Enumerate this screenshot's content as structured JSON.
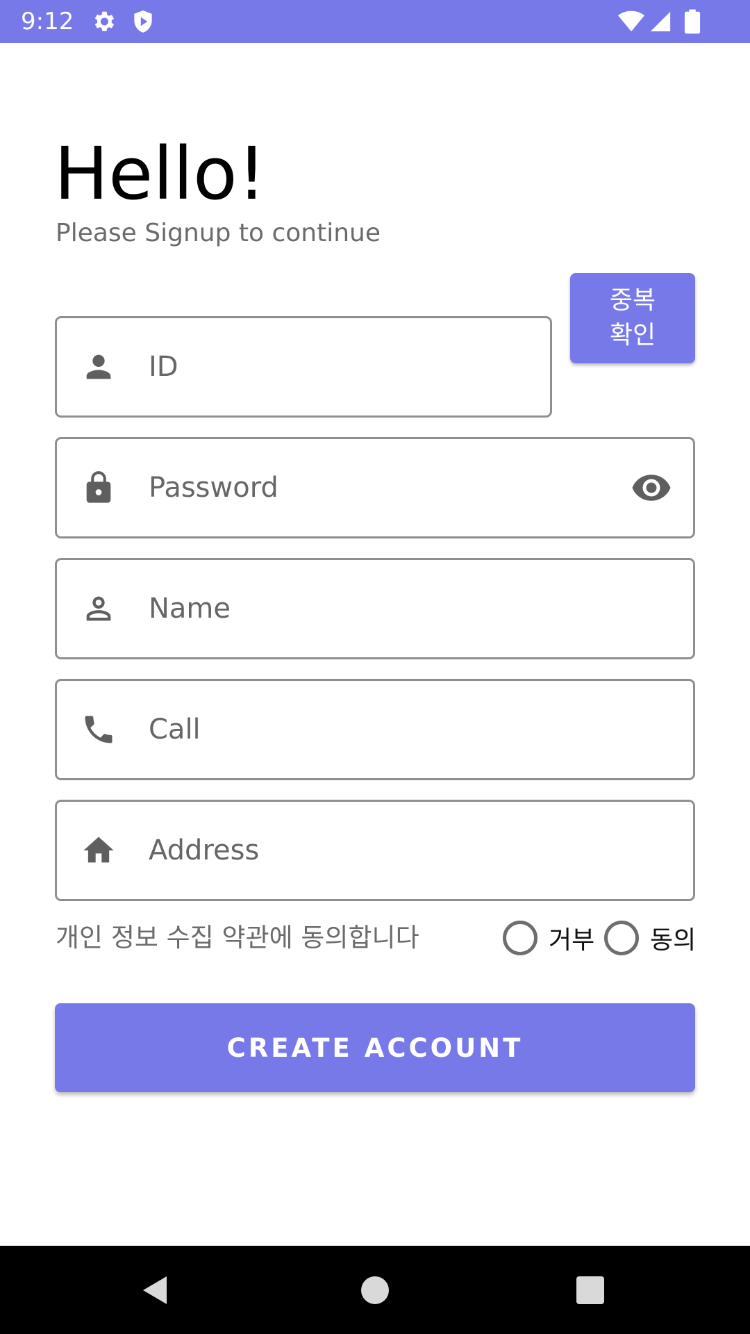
{
  "status_bar": {
    "time": "9:12",
    "icons": [
      "gear-icon",
      "shield-icon",
      "wifi-icon",
      "signal-icon",
      "battery-icon"
    ],
    "color": "#7879e8"
  },
  "header": {
    "title": "Hello!",
    "subtitle": "Please Signup to continue"
  },
  "form": {
    "id": {
      "placeholder": "ID",
      "value": "",
      "icon": "person-icon"
    },
    "dup_check_label": "중복\n확인",
    "password": {
      "placeholder": "Password",
      "value": "",
      "icon": "lock-icon",
      "toggle_icon": "eye-icon"
    },
    "name": {
      "placeholder": "Name",
      "value": "",
      "icon": "person-outline-icon"
    },
    "call": {
      "placeholder": "Call",
      "value": "",
      "icon": "phone-icon"
    },
    "address": {
      "placeholder": "Address",
      "value": "",
      "icon": "home-icon"
    }
  },
  "consent": {
    "label": "개인 정보 수집 약관에 동의합니다",
    "options": [
      {
        "label": "거부",
        "selected": false
      },
      {
        "label": "동의",
        "selected": false
      }
    ]
  },
  "create_button": "CREATE ACCOUNT",
  "nav_bar": {
    "buttons": [
      "back-icon",
      "home-circle-icon",
      "recents-icon"
    ]
  },
  "colors": {
    "accent": "#7879e8",
    "outline": "#8f8f8f",
    "icon": "#5f5f5f"
  }
}
